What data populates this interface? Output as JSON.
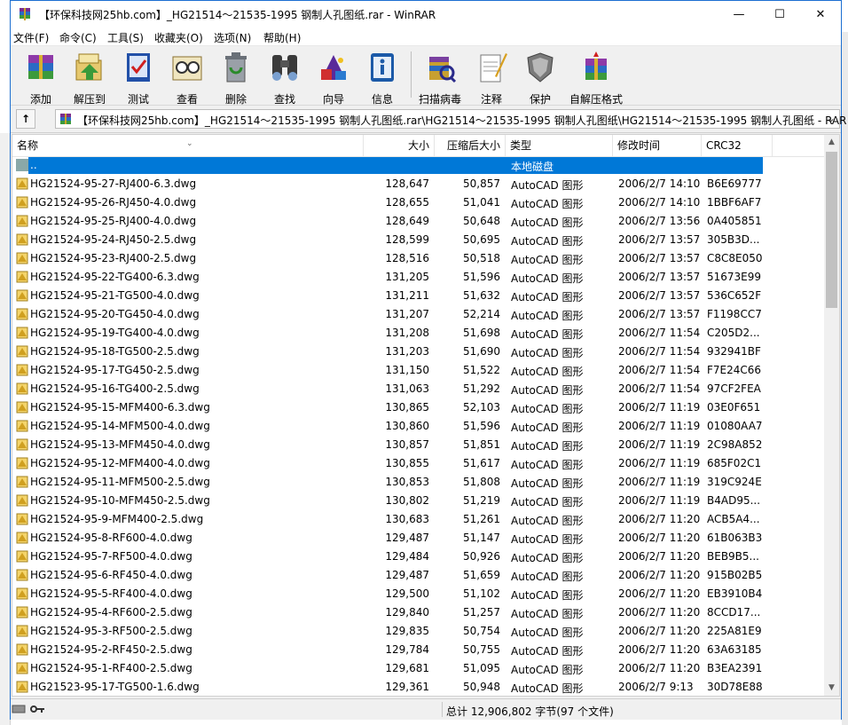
{
  "window": {
    "title": "【环保科技网25hb.com】_HG21514～21535-1995 钢制人孔图纸.rar - WinRAR",
    "minimize": "—",
    "maximize": "☐",
    "close": "✕"
  },
  "menu": [
    "文件(F)",
    "命令(C)",
    "工具(S)",
    "收藏夹(O)",
    "选项(N)",
    "帮助(H)"
  ],
  "toolbar": [
    {
      "label": "添加",
      "icon": "add-archive-icon"
    },
    {
      "label": "解压到",
      "icon": "extract-to-icon"
    },
    {
      "label": "测试",
      "icon": "test-icon"
    },
    {
      "label": "查看",
      "icon": "view-icon"
    },
    {
      "label": "删除",
      "icon": "delete-icon"
    },
    {
      "label": "查找",
      "icon": "find-icon"
    },
    {
      "label": "向导",
      "icon": "wizard-icon"
    },
    {
      "label": "信息",
      "icon": "info-icon"
    },
    {
      "label": "扫描病毒",
      "icon": "virus-scan-icon"
    },
    {
      "label": "注释",
      "icon": "comment-icon"
    },
    {
      "label": "保护",
      "icon": "protect-icon"
    },
    {
      "label": "自解压格式",
      "icon": "sfx-icon"
    }
  ],
  "address": {
    "up_label": "↑",
    "path": "【环保科技网25hb.com】_HG21514～21535-1995 钢制人孔图纸.rar\\HG21514～21535-1995 钢制人孔图纸\\HG21514～21535-1995 钢制人孔图纸 - RAR",
    "dropdown": "⌄"
  },
  "columns": [
    "名称",
    "大小",
    "压缩后大小",
    "类型",
    "修改时间",
    "CRC32"
  ],
  "parent_row": {
    "name": "..",
    "type": "本地磁盘"
  },
  "files": [
    {
      "name": "HG21524-95-27-RJ400-6.3.dwg",
      "size": "128,647",
      "packed": "50,857",
      "type": "AutoCAD 图形",
      "modified": "2006/2/7 14:10",
      "crc": "B6E69777"
    },
    {
      "name": "HG21524-95-26-RJ450-4.0.dwg",
      "size": "128,655",
      "packed": "51,041",
      "type": "AutoCAD 图形",
      "modified": "2006/2/7 14:10",
      "crc": "1BBF6AF7"
    },
    {
      "name": "HG21524-95-25-RJ400-4.0.dwg",
      "size": "128,649",
      "packed": "50,648",
      "type": "AutoCAD 图形",
      "modified": "2006/2/7 13:56",
      "crc": "0A405851"
    },
    {
      "name": "HG21524-95-24-RJ450-2.5.dwg",
      "size": "128,599",
      "packed": "50,695",
      "type": "AutoCAD 图形",
      "modified": "2006/2/7 13:57",
      "crc": "305B3D..."
    },
    {
      "name": "HG21524-95-23-RJ400-2.5.dwg",
      "size": "128,516",
      "packed": "50,518",
      "type": "AutoCAD 图形",
      "modified": "2006/2/7 13:57",
      "crc": "C8C8E050"
    },
    {
      "name": "HG21524-95-22-TG400-6.3.dwg",
      "size": "131,205",
      "packed": "51,596",
      "type": "AutoCAD 图形",
      "modified": "2006/2/7 13:57",
      "crc": "51673E99"
    },
    {
      "name": "HG21524-95-21-TG500-4.0.dwg",
      "size": "131,211",
      "packed": "51,632",
      "type": "AutoCAD 图形",
      "modified": "2006/2/7 13:57",
      "crc": "536C652F"
    },
    {
      "name": "HG21524-95-20-TG450-4.0.dwg",
      "size": "131,207",
      "packed": "52,214",
      "type": "AutoCAD 图形",
      "modified": "2006/2/7 13:57",
      "crc": "F1198CC7"
    },
    {
      "name": "HG21524-95-19-TG400-4.0.dwg",
      "size": "131,208",
      "packed": "51,698",
      "type": "AutoCAD 图形",
      "modified": "2006/2/7 11:54",
      "crc": "C205D2..."
    },
    {
      "name": "HG21524-95-18-TG500-2.5.dwg",
      "size": "131,203",
      "packed": "51,690",
      "type": "AutoCAD 图形",
      "modified": "2006/2/7 11:54",
      "crc": "932941BF"
    },
    {
      "name": "HG21524-95-17-TG450-2.5.dwg",
      "size": "131,150",
      "packed": "51,522",
      "type": "AutoCAD 图形",
      "modified": "2006/2/7 11:54",
      "crc": "F7E24C66"
    },
    {
      "name": "HG21524-95-16-TG400-2.5.dwg",
      "size": "131,063",
      "packed": "51,292",
      "type": "AutoCAD 图形",
      "modified": "2006/2/7 11:54",
      "crc": "97CF2FEA"
    },
    {
      "name": "HG21524-95-15-MFM400-6.3.dwg",
      "size": "130,865",
      "packed": "52,103",
      "type": "AutoCAD 图形",
      "modified": "2006/2/7 11:19",
      "crc": "03E0F651"
    },
    {
      "name": "HG21524-95-14-MFM500-4.0.dwg",
      "size": "130,860",
      "packed": "51,596",
      "type": "AutoCAD 图形",
      "modified": "2006/2/7 11:19",
      "crc": "01080AA7"
    },
    {
      "name": "HG21524-95-13-MFM450-4.0.dwg",
      "size": "130,857",
      "packed": "51,851",
      "type": "AutoCAD 图形",
      "modified": "2006/2/7 11:19",
      "crc": "2C98A852"
    },
    {
      "name": "HG21524-95-12-MFM400-4.0.dwg",
      "size": "130,855",
      "packed": "51,617",
      "type": "AutoCAD 图形",
      "modified": "2006/2/7 11:19",
      "crc": "685F02C1"
    },
    {
      "name": "HG21524-95-11-MFM500-2.5.dwg",
      "size": "130,853",
      "packed": "51,808",
      "type": "AutoCAD 图形",
      "modified": "2006/2/7 11:19",
      "crc": "319C924E"
    },
    {
      "name": "HG21524-95-10-MFM450-2.5.dwg",
      "size": "130,802",
      "packed": "51,219",
      "type": "AutoCAD 图形",
      "modified": "2006/2/7 11:19",
      "crc": "B4AD95..."
    },
    {
      "name": "HG21524-95-9-MFM400-2.5.dwg",
      "size": "130,683",
      "packed": "51,261",
      "type": "AutoCAD 图形",
      "modified": "2006/2/7 11:20",
      "crc": "ACB5A4..."
    },
    {
      "name": "HG21524-95-8-RF600-4.0.dwg",
      "size": "129,487",
      "packed": "51,147",
      "type": "AutoCAD 图形",
      "modified": "2006/2/7 11:20",
      "crc": "61B063B3"
    },
    {
      "name": "HG21524-95-7-RF500-4.0.dwg",
      "size": "129,484",
      "packed": "50,926",
      "type": "AutoCAD 图形",
      "modified": "2006/2/7 11:20",
      "crc": "BEB9B5..."
    },
    {
      "name": "HG21524-95-6-RF450-4.0.dwg",
      "size": "129,487",
      "packed": "51,659",
      "type": "AutoCAD 图形",
      "modified": "2006/2/7 11:20",
      "crc": "915B02B5"
    },
    {
      "name": "HG21524-95-5-RF400-4.0.dwg",
      "size": "129,500",
      "packed": "51,102",
      "type": "AutoCAD 图形",
      "modified": "2006/2/7 11:20",
      "crc": "EB3910B4"
    },
    {
      "name": "HG21524-95-4-RF600-2.5.dwg",
      "size": "129,840",
      "packed": "51,257",
      "type": "AutoCAD 图形",
      "modified": "2006/2/7 11:20",
      "crc": "8CCD17..."
    },
    {
      "name": "HG21524-95-3-RF500-2.5.dwg",
      "size": "129,835",
      "packed": "50,754",
      "type": "AutoCAD 图形",
      "modified": "2006/2/7 11:20",
      "crc": "225A81E9"
    },
    {
      "name": "HG21524-95-2-RF450-2.5.dwg",
      "size": "129,784",
      "packed": "50,755",
      "type": "AutoCAD 图形",
      "modified": "2006/2/7 11:20",
      "crc": "63A63185"
    },
    {
      "name": "HG21524-95-1-RF400-2.5.dwg",
      "size": "129,681",
      "packed": "51,095",
      "type": "AutoCAD 图形",
      "modified": "2006/2/7 11:20",
      "crc": "B3EA2391"
    },
    {
      "name": "HG21523-95-17-TG500-1.6.dwg",
      "size": "129,361",
      "packed": "50,948",
      "type": "AutoCAD 图形",
      "modified": "2006/2/7 9:13",
      "crc": "30D78E88"
    }
  ],
  "scrollbar": {
    "up": "▲",
    "down": "▼"
  },
  "status": {
    "text": "总计 12,906,802 字节(97 个文件)"
  },
  "colors": {
    "selection": "#0078d7",
    "title_border": "#1c6fd1"
  }
}
